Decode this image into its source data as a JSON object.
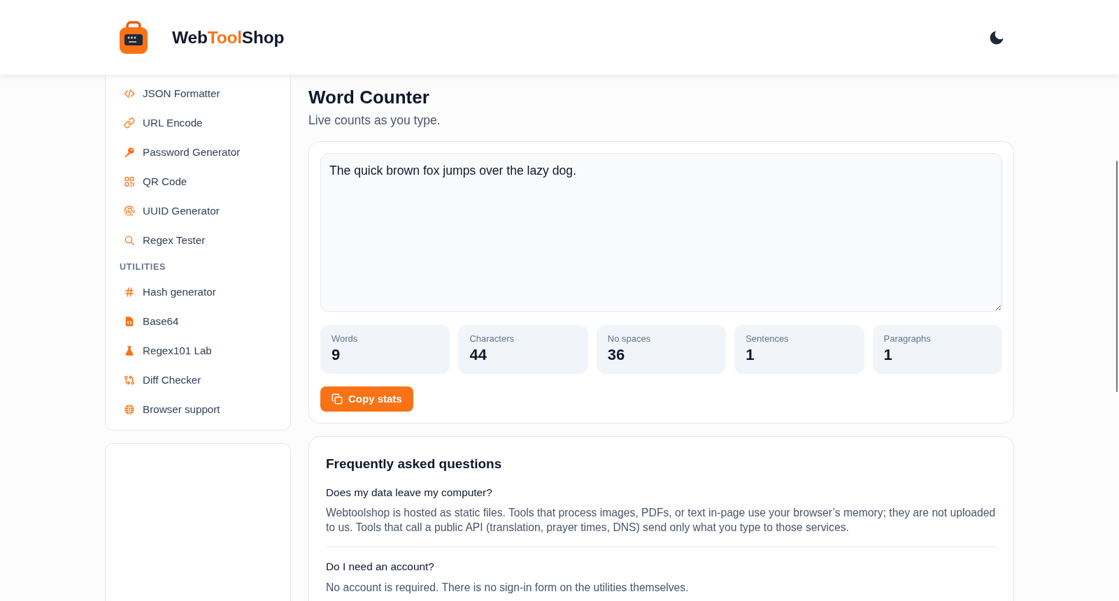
{
  "header": {
    "brand": [
      {
        "text": "Web",
        "accent": false
      },
      {
        "text": "Tool",
        "accent": true
      },
      {
        "text": "Shop",
        "accent": false
      }
    ]
  },
  "sidebar": {
    "groups": [
      {
        "items": [
          {
            "label": "JSON Formatter",
            "selected": false
          },
          {
            "label": "URL Encode",
            "selected": false
          },
          {
            "label": "Password Generator",
            "selected": false
          },
          {
            "label": "QR Code",
            "selected": false
          },
          {
            "label": "UUID Generator",
            "selected": false
          },
          {
            "label": "Regex Tester",
            "selected": false
          }
        ]
      },
      {
        "heading": "UTILITIES",
        "items": [
          {
            "label": "Hash generator",
            "selected": false
          },
          {
            "label": "Base64",
            "selected": false
          },
          {
            "label": "Regex101 Lab",
            "selected": false
          },
          {
            "label": "Diff Checker",
            "selected": false
          },
          {
            "label": "Browser support",
            "selected": false
          }
        ]
      }
    ]
  },
  "page": {
    "title": "Word Counter",
    "subtitle": "Live counts as you type."
  },
  "counter": {
    "text": "The quick brown fox jumps over the lazy dog.",
    "stats": [
      {
        "label": "Words",
        "value": "9"
      },
      {
        "label": "Characters",
        "value": "44"
      },
      {
        "label": "No spaces",
        "value": "36"
      },
      {
        "label": "Sentences",
        "value": "1"
      },
      {
        "label": "Paragraphs",
        "value": "1"
      }
    ],
    "copy_button": "Copy stats"
  },
  "faq": {
    "title": "Frequently asked questions",
    "items": [
      {
        "question": "Does my data leave my computer?",
        "answer": "Webtoolshop is hosted as static files. Tools that process images, PDFs, or text in-page use your browser’s memory; they are not uploaded to us. Tools that call a public API (translation, prayer times, DNS) send only what you type to those services."
      },
      {
        "question": "Do I need an account?",
        "answer": "No account is required. There is no sign-in form on the utilities themselves."
      }
    ]
  }
}
